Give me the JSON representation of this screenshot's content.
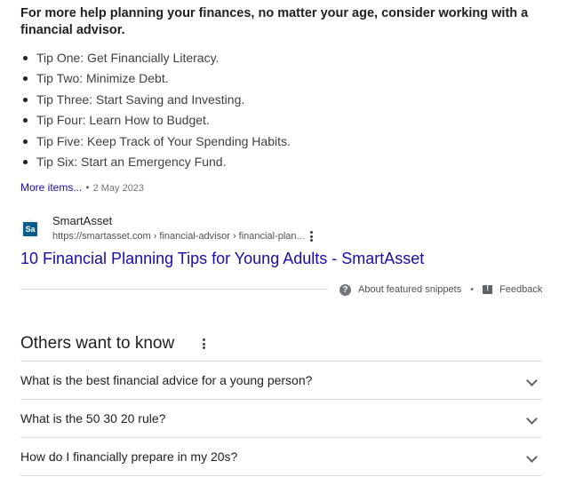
{
  "snippet": {
    "lead": "For more help planning your finances, no matter your age, consider working with a financial advisor.",
    "tips": [
      "Tip One: Get Financially Literacy.",
      "Tip Two: Minimize Debt.",
      "Tip Three: Start Saving and Investing.",
      "Tip Four: Learn How to Budget.",
      "Tip Five: Keep Track of Your Spending Habits.",
      "Tip Six: Start an Emergency Fund."
    ],
    "more_items": "More items...",
    "separator": "•",
    "date": "2 May 2023"
  },
  "source": {
    "favicon_text": "Sa",
    "name": "SmartAsset",
    "url": "https://smartasset.com › financial-advisor › financial-plan...",
    "title": "10 Financial Planning Tips for Young Adults - SmartAsset"
  },
  "footer": {
    "about": "About featured snippets",
    "separator": "•",
    "feedback": "Feedback"
  },
  "others_want_to_know": {
    "heading": "Others want to know",
    "questions": [
      "What is the best financial advice for a young person?",
      "What is the 50 30 20 rule?",
      "How do I financially prepare in my 20s?"
    ]
  },
  "colors": {
    "link": "#1a0dab",
    "text": "#202124",
    "muted": "#70757a",
    "divider": "#dadce0"
  },
  "icons": [
    "more-vert-icon",
    "help-circle-icon",
    "feedback-icon",
    "chevron-down-icon",
    "smartasset-favicon"
  ]
}
